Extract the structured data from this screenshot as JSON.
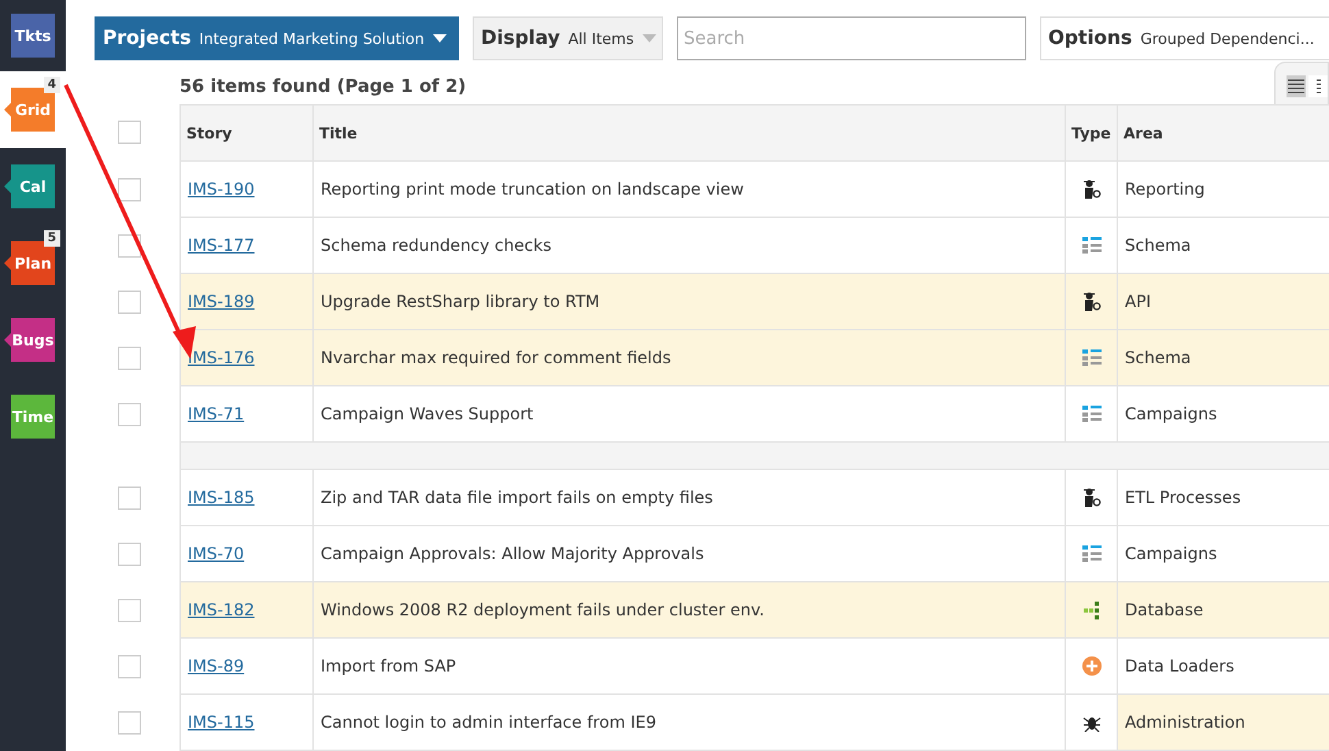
{
  "sidebar": {
    "items": [
      {
        "label": "Tkts",
        "color": "#4a64a8",
        "selected": false,
        "pointer": false
      },
      {
        "label": "Grid",
        "color": "#f47c2a",
        "selected": true,
        "pointer": true,
        "badge": "4"
      },
      {
        "label": "Cal",
        "color": "#16948a",
        "selected": false,
        "pointer": true
      },
      {
        "label": "Plan",
        "color": "#e2451c",
        "selected": false,
        "pointer": true,
        "badge": "5"
      },
      {
        "label": "Bugs",
        "color": "#c42f86",
        "selected": false,
        "pointer": true
      },
      {
        "label": "Time",
        "color": "#5cb73c",
        "selected": false,
        "pointer": false
      }
    ]
  },
  "toolbar": {
    "projects": {
      "label": "Projects",
      "value": "Integrated Marketing Solution"
    },
    "display": {
      "label": "Display",
      "value": "All Items"
    },
    "search": {
      "placeholder": "Search"
    },
    "options": {
      "label": "Options",
      "value": "Grouped Dependenci..."
    }
  },
  "results": {
    "summary": "56 items found (Page 1 of 2)"
  },
  "view_toggle": [
    {
      "kind": "list",
      "selected": true
    },
    {
      "kind": "compact",
      "selected": false
    }
  ],
  "table": {
    "header_checked": false,
    "columns": [
      "Story",
      "Title",
      "Type",
      "Area"
    ],
    "groups": [
      {
        "rows": [
          {
            "story": "IMS-190",
            "title": "Reporting print mode truncation on landscape view",
            "kind": "defect",
            "area": "Reporting",
            "highlighted": false,
            "area_highlighted": false,
            "checked": false
          },
          {
            "story": "IMS-177",
            "title": "Schema redundency checks",
            "kind": "story",
            "area": "Schema",
            "highlighted": false,
            "area_highlighted": false,
            "checked": false
          },
          {
            "story": "IMS-189",
            "title": "Upgrade RestSharp library to RTM",
            "kind": "defect",
            "area": "API",
            "highlighted": true,
            "area_highlighted": true,
            "checked": false
          },
          {
            "story": "IMS-176",
            "title": "Nvarchar max required for comment fields",
            "kind": "story",
            "area": "Schema",
            "highlighted": true,
            "area_highlighted": true,
            "checked": false
          },
          {
            "story": "IMS-71",
            "title": "Campaign Waves Support",
            "kind": "story",
            "area": "Campaigns",
            "highlighted": false,
            "area_highlighted": false,
            "checked": false
          }
        ]
      },
      {
        "rows": [
          {
            "story": "IMS-185",
            "title": "Zip and TAR data file import fails on empty files",
            "kind": "defect",
            "area": "ETL Processes",
            "highlighted": false,
            "area_highlighted": false,
            "checked": false
          },
          {
            "story": "IMS-70",
            "title": "Campaign Approvals: Allow Majority Approvals",
            "kind": "story",
            "area": "Campaigns",
            "highlighted": false,
            "area_highlighted": false,
            "checked": false
          },
          {
            "story": "IMS-182",
            "title": "Windows 2008 R2 deployment fails under cluster env.",
            "kind": "task",
            "area": "Database",
            "highlighted": true,
            "area_highlighted": true,
            "checked": false
          },
          {
            "story": "IMS-89",
            "title": "Import from SAP",
            "kind": "feature",
            "area": "Data Loaders",
            "highlighted": false,
            "area_highlighted": false,
            "checked": false
          },
          {
            "story": "IMS-115",
            "title": "Cannot login to admin interface from IE9",
            "kind": "bug",
            "area": "Administration",
            "highlighted": false,
            "area_highlighted": true,
            "checked": false
          }
        ]
      }
    ]
  },
  "annotation": {
    "kind": "arrow"
  }
}
